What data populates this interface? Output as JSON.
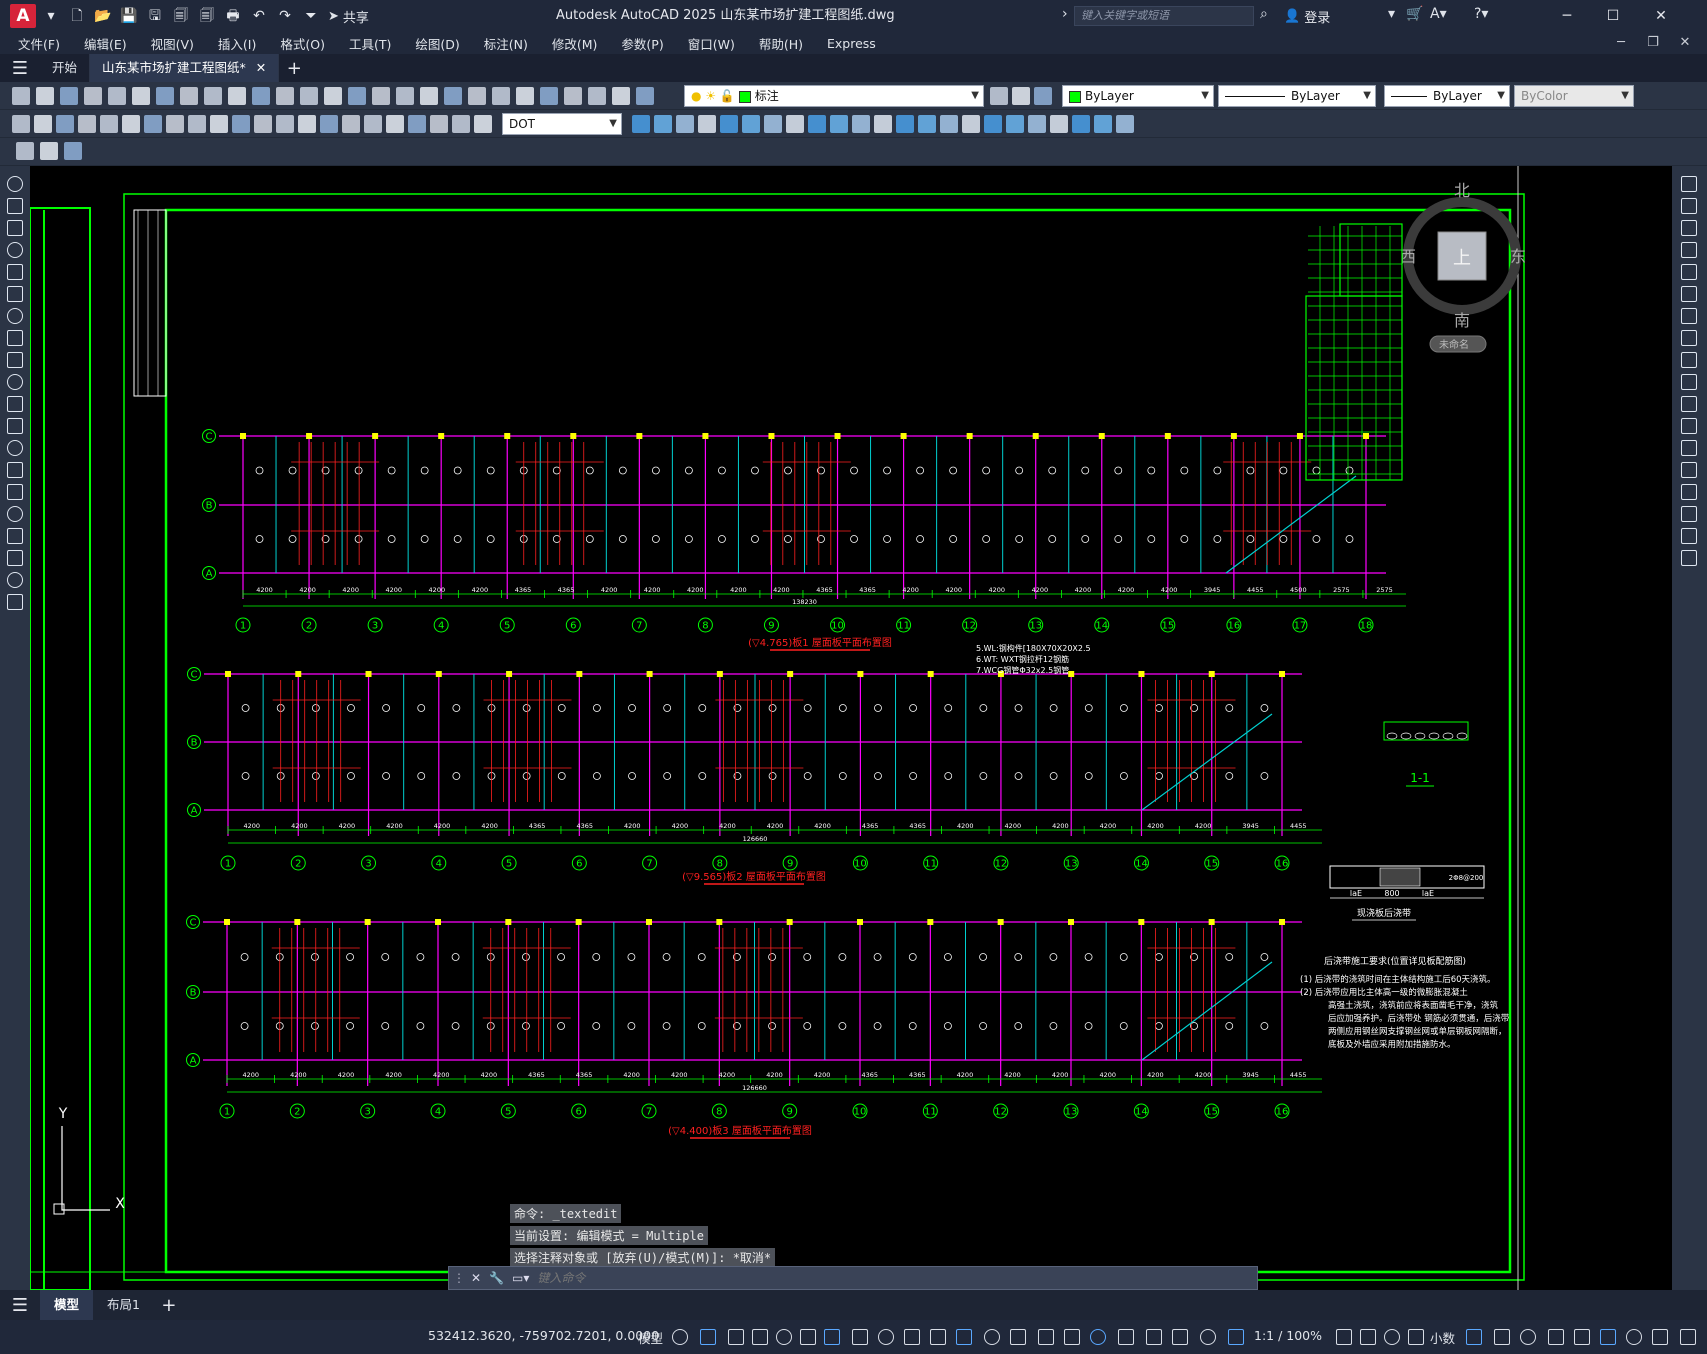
{
  "titlebar": {
    "logo": "A",
    "share": "共享",
    "title": "Autodesk AutoCAD 2025    山东某市场扩建工程图纸.dwg",
    "search_placeholder": "键入关键字或短语",
    "login": "登录"
  },
  "menus": [
    "文件(F)",
    "编辑(E)",
    "视图(V)",
    "插入(I)",
    "格式(O)",
    "工具(T)",
    "绘图(D)",
    "标注(N)",
    "修改(M)",
    "参数(P)",
    "窗口(W)",
    "帮助(H)",
    "Express"
  ],
  "tabs": {
    "start": "开始",
    "drawing": "山东某市场扩建工程图纸*"
  },
  "toolbar": {
    "layer_combo": "标注",
    "color_combo": "ByLayer",
    "linetype_combo": "ByLayer",
    "lineweight_combo": "ByLayer",
    "plotstyle_combo": "ByColor",
    "dimstyle_combo": "DOT"
  },
  "viewcube": {
    "north": "北",
    "south": "南",
    "west": "西",
    "east": "东",
    "face": "上",
    "ucs": "未命名"
  },
  "ucs": {
    "y": "Y",
    "x": "X"
  },
  "plans": [
    {
      "axes_cols": [
        "1",
        "2",
        "3",
        "4",
        "5",
        "6",
        "7",
        "8",
        "9",
        "10",
        "11",
        "12",
        "13",
        "14",
        "15",
        "16",
        "17",
        "18"
      ],
      "axes_rows": [
        "C",
        "B",
        "A"
      ],
      "spans": [
        "4200",
        "4200",
        "4200",
        "4200",
        "4200",
        "4200",
        "4365",
        "4365",
        "4200",
        "4200",
        "4200",
        "4200",
        "4200",
        "4365",
        "4365",
        "4200",
        "4200",
        "4200",
        "4200",
        "4200",
        "4200",
        "4200",
        "3945",
        "4455",
        "4500",
        "2575",
        "2575"
      ],
      "total": "138230",
      "title": "(▽4.765)板1 屋面板平面布置图"
    },
    {
      "axes_cols": [
        "1",
        "2",
        "3",
        "4",
        "5",
        "6",
        "7",
        "8",
        "9",
        "10",
        "11",
        "12",
        "13",
        "14",
        "15",
        "16"
      ],
      "axes_rows": [
        "C",
        "B",
        "A"
      ],
      "spans": [
        "4200",
        "4200",
        "4200",
        "4200",
        "4200",
        "4200",
        "4365",
        "4365",
        "4200",
        "4200",
        "4200",
        "4200",
        "4200",
        "4365",
        "4365",
        "4200",
        "4200",
        "4200",
        "4200",
        "4200",
        "4200",
        "3945",
        "4455"
      ],
      "total": "126660",
      "title": "(▽9.565)板2 屋面板平面布置图"
    },
    {
      "axes_cols": [
        "1",
        "2",
        "3",
        "4",
        "5",
        "6",
        "7",
        "8",
        "9",
        "10",
        "11",
        "12",
        "13",
        "14",
        "15",
        "16"
      ],
      "axes_rows": [
        "C",
        "B",
        "A"
      ],
      "spans": [
        "4200",
        "4200",
        "4200",
        "4200",
        "4200",
        "4200",
        "4365",
        "4365",
        "4200",
        "4200",
        "4200",
        "4200",
        "4200",
        "4365",
        "4365",
        "4200",
        "4200",
        "4200",
        "4200",
        "4200",
        "4200",
        "3945",
        "4455"
      ],
      "total": "126660",
      "title": "(▽4.400)板3 屋面板平面布置图"
    }
  ],
  "notes1": [
    "5.WL:钢构件[180X70X20X2.5",
    "6.WT: WXT钢拉杆12钢筋",
    "7.WCG钢管Φ32x2.5钢管"
  ],
  "section_label": "1-1",
  "detail_label": "现浇板后浇带",
  "detail_dims": [
    "laE",
    "800",
    "laE"
  ],
  "detail_rebar": "2Φ8@200",
  "postcast_title": "后浇带施工要求(位置详见板配筋图)",
  "postcast_notes": [
    "(1) 后浇带的浇筑时间在主体结构施工后60天浇筑。",
    "(2) 后浇带应用比主体高一级的微膨胀混凝土",
    "高强土浇筑，浇筑前应将表面凿毛干净，浇筑",
    "后应加强养护。后浇带处 钢筋必须贯通，后浇带",
    "两侧应用钢丝网支撑钢丝网或单层钢板网隔断，",
    "底板及外墙应采用附加措施防水。"
  ],
  "command": {
    "history": [
      "命令: _textedit",
      "当前设置: 编辑模式 = Multiple",
      "选择注释对象或 [放弃(U)/模式(M)]: *取消*"
    ],
    "placeholder": "键入命令"
  },
  "layouts": [
    "模型",
    "布局1"
  ],
  "status": {
    "coords": "532412.3620, -759702.7201, 0.0000",
    "model": "模型",
    "scale": "1:1 / 100%",
    "units": "小数"
  },
  "colors": {
    "green": "#00ff00",
    "magenta": "#ff00ff",
    "cyan": "#00d0d0",
    "red": "#ff2020",
    "yellow": "#ffff00",
    "white": "#ffffff"
  }
}
